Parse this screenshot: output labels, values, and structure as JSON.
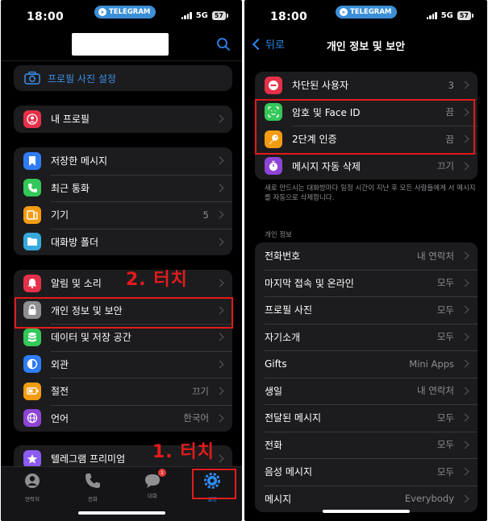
{
  "status_left": {
    "time": "18:00",
    "telegram": "TELEGRAM",
    "network": "5G",
    "battery": "57"
  },
  "status_right": {
    "time": "18:00",
    "telegram": "TELEGRAM",
    "network": "5G",
    "battery": "57"
  },
  "left": {
    "profile_photo_label": "프로필 사진 설정",
    "my_profile": "내 프로필",
    "group2": [
      {
        "label": "저장한 메시지",
        "value": ""
      },
      {
        "label": "최근 통화",
        "value": ""
      },
      {
        "label": "기기",
        "value": "5"
      },
      {
        "label": "대화방 폴더",
        "value": ""
      }
    ],
    "group3": [
      {
        "label": "알림 및 소리",
        "value": ""
      },
      {
        "label": "개인 정보 및 보안",
        "value": ""
      },
      {
        "label": "데이터 및 저장 공간",
        "value": ""
      },
      {
        "label": "외관",
        "value": ""
      },
      {
        "label": "절전",
        "value": "끄기"
      },
      {
        "label": "언어",
        "value": "한국어"
      }
    ],
    "premium": "텔레그램 프리미엄",
    "tabs": [
      {
        "label": "연락처"
      },
      {
        "label": "전화"
      },
      {
        "label": "대화",
        "badge": "1"
      },
      {
        "label": "설정"
      }
    ],
    "annotation_1": "1. 터치",
    "annotation_2": "2. 터치"
  },
  "right": {
    "back_label": "뒤로",
    "title": "개인 정보 및 보안",
    "security": [
      {
        "label": "차단된 사용자",
        "value": "3"
      },
      {
        "label": "암호 및 Face ID",
        "value": "끔"
      },
      {
        "label": "2단계 인증",
        "value": "끔"
      },
      {
        "label": "메시지 자동 삭제",
        "value": "끄기"
      }
    ],
    "note": "새로 만드시는 대화방마다 일정 시간이 지난 후 모든 사람들에게 서 메시지를 자동으로 삭제합니다.",
    "privacy_header": "개인 정보",
    "privacy": [
      {
        "label": "전화번호",
        "value": "내 연락처"
      },
      {
        "label": "마지막 접속 및 온라인",
        "value": "모두"
      },
      {
        "label": "프로필 사진",
        "value": "모두"
      },
      {
        "label": "자기소개",
        "value": "모두"
      },
      {
        "label": "Gifts",
        "value": "Mini Apps"
      },
      {
        "label": "생일",
        "value": "내 연락처"
      },
      {
        "label": "전달된 메시지",
        "value": "모두"
      },
      {
        "label": "전화",
        "value": "모두"
      },
      {
        "label": "음성 메시지",
        "value": "모두"
      },
      {
        "label": "메시지",
        "value": "Everybody"
      }
    ]
  },
  "colors": {
    "accent": "#2f8bf0",
    "annotation_red": "#e31b1b",
    "cell_bg": "#1c1c1e"
  }
}
